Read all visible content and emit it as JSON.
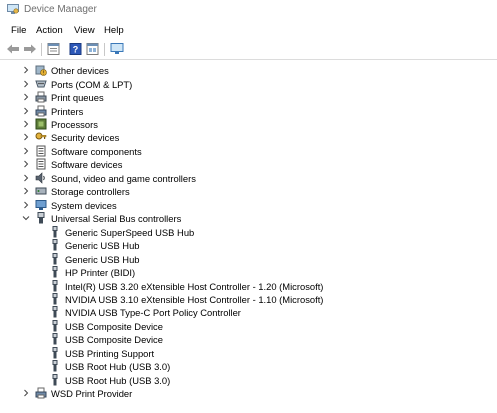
{
  "window": {
    "title": "Device Manager"
  },
  "menu": [
    "File",
    "Action",
    "View",
    "Help"
  ],
  "tree": {
    "categories_top": [
      {
        "label": "Other devices",
        "icon": "other-devices-icon"
      },
      {
        "label": "Ports (COM & LPT)",
        "icon": "port-icon"
      },
      {
        "label": "Print queues",
        "icon": "print-queue-icon"
      },
      {
        "label": "Printers",
        "icon": "printer-icon"
      },
      {
        "label": "Processors",
        "icon": "processor-icon"
      },
      {
        "label": "Security devices",
        "icon": "security-icon"
      },
      {
        "label": "Software components",
        "icon": "software-component-icon"
      },
      {
        "label": "Software devices",
        "icon": "software-device-icon"
      },
      {
        "label": "Sound, video and game controllers",
        "icon": "sound-icon"
      },
      {
        "label": "Storage controllers",
        "icon": "storage-icon"
      },
      {
        "label": "System devices",
        "icon": "system-icon"
      }
    ],
    "usb_category": {
      "label": "Universal Serial Bus controllers",
      "icon": "usb-icon"
    },
    "usb_children": [
      "Generic SuperSpeed USB Hub",
      "Generic USB Hub",
      "Generic USB Hub",
      "HP Printer (BIDI)",
      "Intel(R) USB 3.20 eXtensible Host Controller - 1.20 (Microsoft)",
      "NVIDIA USB 3.10 eXtensible Host Controller - 1.10 (Microsoft)",
      "NVIDIA USB Type-C Port Policy Controller",
      "USB Composite Device",
      "USB Composite Device",
      "USB Printing Support",
      "USB Root Hub (USB 3.0)",
      "USB Root Hub (USB 3.0)"
    ],
    "categories_bottom": [
      {
        "label": "WSD Print Provider",
        "icon": "wsd-icon"
      }
    ]
  }
}
